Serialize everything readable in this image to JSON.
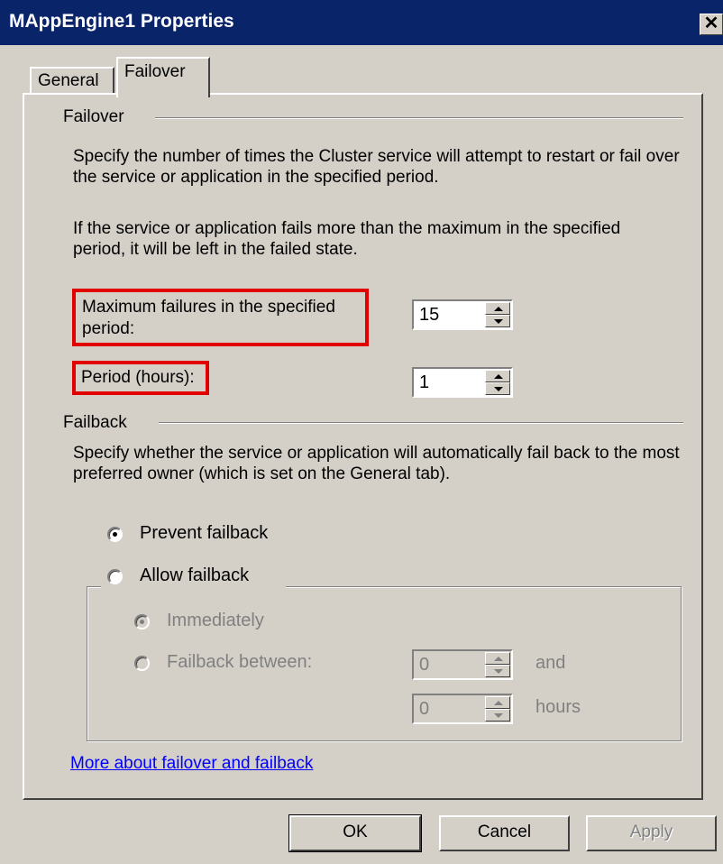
{
  "window": {
    "title": "MAppEngine1 Properties",
    "close_glyph": "✕"
  },
  "tabs": [
    {
      "label": "General",
      "active": false
    },
    {
      "label": "Failover",
      "active": true
    }
  ],
  "failover": {
    "heading": "Failover",
    "description1": "Specify the number of times the Cluster service will attempt to restart or fail over the service or application in the specified period.",
    "description2": "If the service or application fails more than the maximum in the specified period, it will be left in the failed state.",
    "max_failures_label": "Maximum failures in the specified period:",
    "max_failures_value": "15",
    "period_label": "Period (hours):",
    "period_value": "1"
  },
  "failback": {
    "heading": "Failback",
    "description": "Specify whether the service or application will automatically fail back to the most preferred owner (which is set on the General tab).",
    "prevent_label": "Prevent failback",
    "allow_label": "Allow failback",
    "immediately_label": "Immediately",
    "between_label": "Failback between:",
    "between_start": "0",
    "and_label": "and",
    "between_end": "0",
    "hours_label": "hours"
  },
  "help_link": "More about failover and failback",
  "buttons": {
    "ok": "OK",
    "cancel": "Cancel",
    "apply": "Apply"
  },
  "colors": {
    "titlebar": "#0a246a",
    "highlight_box": "#e00000",
    "link": "#0000ff"
  }
}
